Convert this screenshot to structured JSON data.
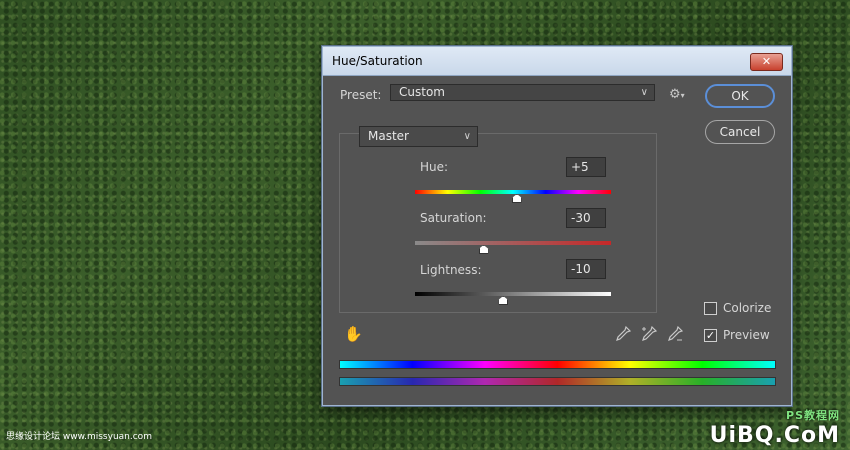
{
  "dialog": {
    "title": "Hue/Saturation",
    "close_glyph": "✕"
  },
  "preset": {
    "label": "Preset:",
    "value": "Custom",
    "settings_icon": "gear-icon"
  },
  "buttons": {
    "ok": "OK",
    "cancel": "Cancel"
  },
  "channel": {
    "value": "Master"
  },
  "sliders": {
    "hue": {
      "label": "Hue:",
      "value": "+5",
      "level": 0.52
    },
    "saturation": {
      "label": "Saturation:",
      "value": "-30",
      "level": 0.35
    },
    "lightness": {
      "label": "Lightness:",
      "value": "-10",
      "level": 0.45
    }
  },
  "options": {
    "colorize": {
      "label": "Colorize",
      "checked": false
    },
    "preview": {
      "label": "Preview",
      "checked": true,
      "check_glyph": "✓"
    }
  },
  "icons": {
    "target_adjust": "hand-icon",
    "eyedropper": "eyedropper-icon",
    "eyedropper_plus": "eyedropper-plus-icon",
    "eyedropper_minus": "eyedropper-minus-icon"
  },
  "colors": {
    "dialog_bg": "#535353",
    "accent_blue": "#5b8fd8",
    "close_red": "#c8412e"
  },
  "watermark": {
    "left_text": "思缘设计论坛 www.missyuan.com",
    "logo_text": "UiBQ.CoM",
    "logo_sub": "PS教程网"
  }
}
